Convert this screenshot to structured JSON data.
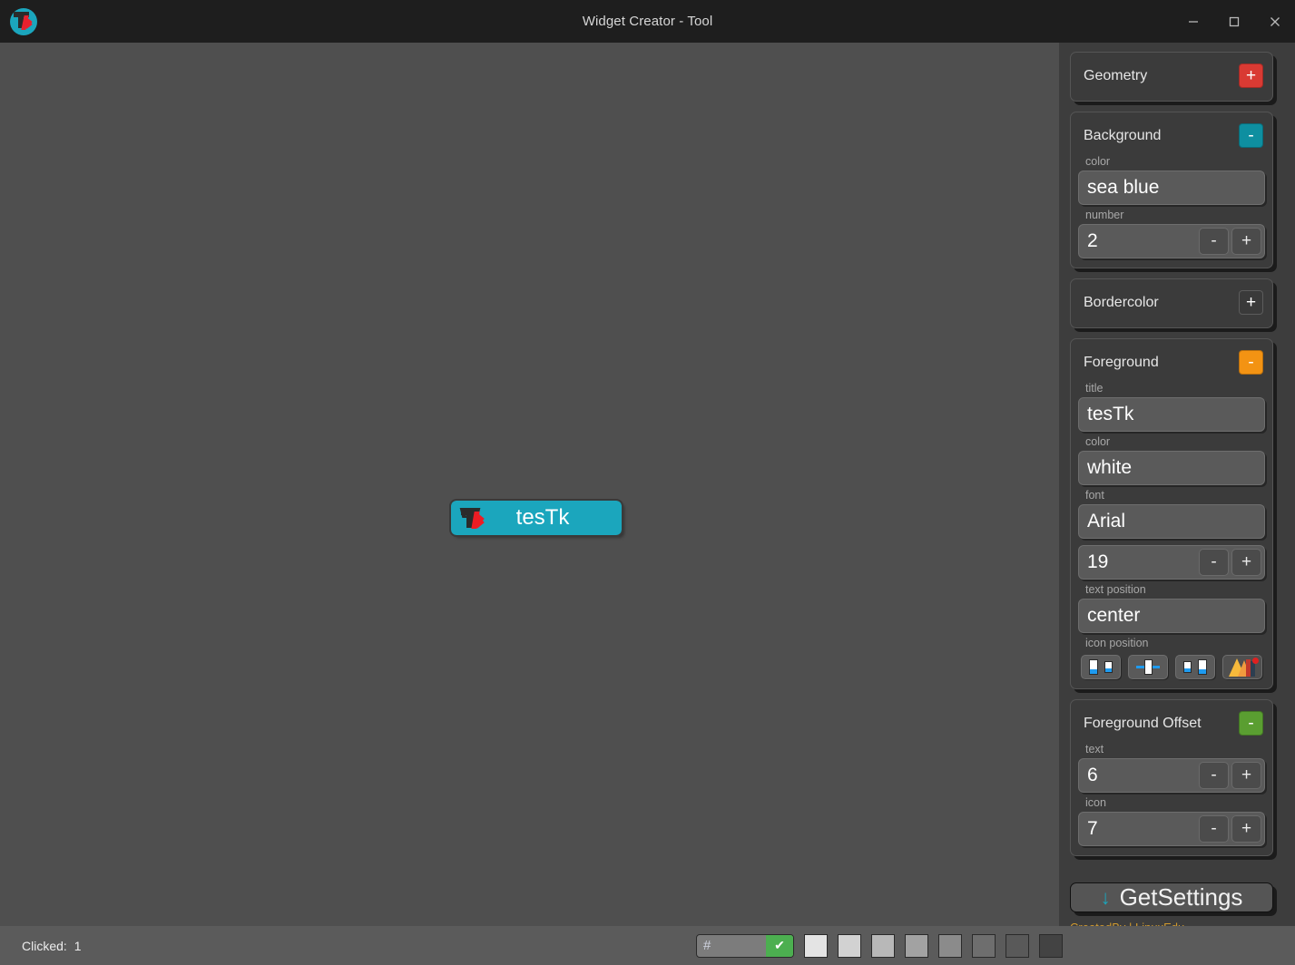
{
  "window": {
    "title": "Widget Creator - Tool",
    "logo_icon": "tk-logo-icon",
    "minimize_icon": "minimize-icon",
    "maximize_icon": "maximize-icon",
    "close_icon": "close-icon"
  },
  "preview": {
    "label": "tesTk",
    "icon": "tk-logo-icon",
    "background_color": "#1ba6bd",
    "text_color": "#ffffff"
  },
  "sidebar": {
    "sections": [
      {
        "title": "Geometry",
        "toggle": "+",
        "toggle_color": "#d93a33",
        "expanded": false,
        "fields": []
      },
      {
        "title": "Background",
        "toggle": "-",
        "toggle_color": "#0e8fa0",
        "expanded": true,
        "fields": [
          {
            "label": "color",
            "value": "sea blue",
            "type": "text"
          },
          {
            "label": "number",
            "value": "2",
            "type": "spinner",
            "minus": "-",
            "plus": "+"
          }
        ]
      },
      {
        "title": "Bordercolor",
        "toggle": "+",
        "toggle_color": "#3a3a3a",
        "expanded": false,
        "fields": []
      },
      {
        "title": "Foreground",
        "toggle": "-",
        "toggle_color": "#f39313",
        "expanded": true,
        "fields": [
          {
            "label": "title",
            "value": "tesTk",
            "type": "text"
          },
          {
            "label": "color",
            "value": "white",
            "type": "text"
          },
          {
            "label": "font",
            "value": "Arial",
            "type": "text"
          },
          {
            "label": "",
            "value": "19",
            "type": "spinner",
            "minus": "-",
            "plus": "+"
          },
          {
            "label": "text position",
            "value": "center",
            "type": "text"
          },
          {
            "label": "icon position",
            "type": "iconrow"
          }
        ]
      },
      {
        "title": "Foreground Offset",
        "toggle": "-",
        "toggle_color": "#5a9e31",
        "expanded": true,
        "fields": [
          {
            "label": "text",
            "value": "6",
            "type": "spinner",
            "minus": "-",
            "plus": "+"
          },
          {
            "label": "icon",
            "value": "7",
            "type": "spinner",
            "minus": "-",
            "plus": "+"
          }
        ]
      }
    ],
    "icon_position_buttons": [
      {
        "name": "icon-position-left",
        "art": "a"
      },
      {
        "name": "icon-position-center",
        "art": "b"
      },
      {
        "name": "icon-position-right",
        "art": "c"
      },
      {
        "name": "icon-image-picker",
        "art": "picker"
      }
    ],
    "get_settings": {
      "label": "GetSettings",
      "icon": "download-icon",
      "icon_glyph": "↓"
    },
    "credit": "CreatedBy | LinuxEdu"
  },
  "statusbar": {
    "clicked_label": "Clicked:",
    "clicked_count": "1",
    "hash_input": {
      "value": "#",
      "confirm_icon": "check-icon",
      "confirm_glyph": "✔",
      "confirm_color": "#4caf50"
    },
    "swatches": [
      "#e4e4e4",
      "#d2d2d2",
      "#b8b8b8",
      "#a2a2a2",
      "#8b8b8b",
      "#6e6e6e",
      "#595959",
      "#434343"
    ]
  }
}
